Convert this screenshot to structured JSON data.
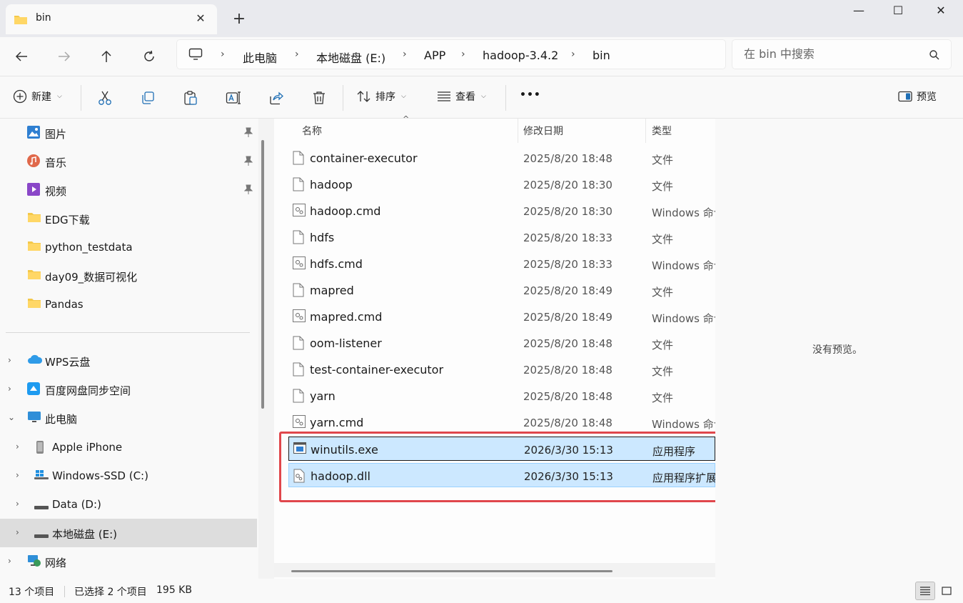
{
  "tab": {
    "title": "bin",
    "close": "✕",
    "new": "+"
  },
  "window": {
    "minimize": "—",
    "maximize": "☐",
    "close": "✕"
  },
  "breadcrumb": [
    "此电脑",
    "本地磁盘 (E:)",
    "APP",
    "hadoop-3.4.2",
    "bin"
  ],
  "breadcrumb_sep": "›",
  "search": {
    "placeholder": "在 bin 中搜索"
  },
  "toolbar": {
    "new_label": "新建",
    "sort_label": "排序",
    "view_label": "查看",
    "more_label": "•••",
    "preview_label": "预览"
  },
  "sidebar": {
    "quick": [
      {
        "label": "图片",
        "icon": "pictures-icon"
      },
      {
        "label": "音乐",
        "icon": "music-icon"
      },
      {
        "label": "视频",
        "icon": "videos-icon"
      },
      {
        "label": "EDG下载",
        "icon": "folder-icon"
      },
      {
        "label": "python_testdata",
        "icon": "folder-icon"
      },
      {
        "label": "day09_数据可视化",
        "icon": "folder-icon"
      },
      {
        "label": "Pandas",
        "icon": "folder-icon"
      }
    ],
    "tree": [
      {
        "label": "WPS云盘",
        "expand": "›"
      },
      {
        "label": "百度网盘同步空间",
        "expand": "›"
      },
      {
        "label": "此电脑",
        "expand": "⌄"
      },
      {
        "label": "Apple iPhone",
        "expand": "›"
      },
      {
        "label": "Windows-SSD (C:)",
        "expand": "›"
      },
      {
        "label": "Data (D:)",
        "expand": "›"
      },
      {
        "label": "本地磁盘 (E:)",
        "expand": "›"
      },
      {
        "label": "网络",
        "expand": "›"
      }
    ]
  },
  "columns": {
    "name": "名称",
    "date": "修改日期",
    "type": "类型"
  },
  "files": [
    {
      "name": "container-executor",
      "date": "2025/8/20 18:48",
      "type": "文件",
      "icon": "file-icon"
    },
    {
      "name": "hadoop",
      "date": "2025/8/20 18:30",
      "type": "文件",
      "icon": "file-icon"
    },
    {
      "name": "hadoop.cmd",
      "date": "2025/8/20 18:30",
      "type": "Windows 命令脚本",
      "icon": "cmd-file-icon"
    },
    {
      "name": "hdfs",
      "date": "2025/8/20 18:33",
      "type": "文件",
      "icon": "file-icon"
    },
    {
      "name": "hdfs.cmd",
      "date": "2025/8/20 18:33",
      "type": "Windows 命令脚本",
      "icon": "cmd-file-icon"
    },
    {
      "name": "mapred",
      "date": "2025/8/20 18:49",
      "type": "文件",
      "icon": "file-icon"
    },
    {
      "name": "mapred.cmd",
      "date": "2025/8/20 18:49",
      "type": "Windows 命令脚本",
      "icon": "cmd-file-icon"
    },
    {
      "name": "oom-listener",
      "date": "2025/8/20 18:48",
      "type": "文件",
      "icon": "file-icon"
    },
    {
      "name": "test-container-executor",
      "date": "2025/8/20 18:48",
      "type": "文件",
      "icon": "file-icon"
    },
    {
      "name": "yarn",
      "date": "2025/8/20 18:48",
      "type": "文件",
      "icon": "file-icon"
    },
    {
      "name": "yarn.cmd",
      "date": "2025/8/20 18:48",
      "type": "Windows 命令脚本",
      "icon": "cmd-file-icon"
    },
    {
      "name": "winutils.exe",
      "date": "2026/3/30 15:13",
      "type": "应用程序",
      "icon": "exe-file-icon",
      "selected": true
    },
    {
      "name": "hadoop.dll",
      "date": "2026/3/30 15:13",
      "type": "应用程序扩展",
      "icon": "dll-file-icon",
      "selected": true
    }
  ],
  "preview": {
    "empty_text": "没有预览。"
  },
  "status": {
    "count": "13 个项目",
    "selected": "已选择 2 个项目",
    "size": "195 KB"
  },
  "colors": {
    "selection": "#cce8ff",
    "highlight": "#e0474c"
  }
}
